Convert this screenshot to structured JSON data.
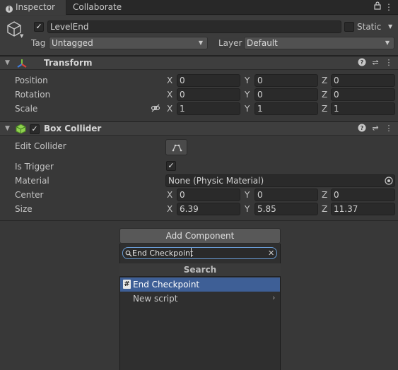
{
  "tabs": {
    "inspector": "Inspector",
    "collaborate": "Collaborate",
    "lock_icon": "lock-icon",
    "menu_icon": "kebab-menu-icon"
  },
  "object": {
    "active_checked": true,
    "name": "LevelEnd",
    "static_label": "Static",
    "tag_label": "Tag",
    "tag_value": "Untagged",
    "layer_label": "Layer",
    "layer_value": "Default"
  },
  "transform": {
    "title": "Transform",
    "position_label": "Position",
    "rotation_label": "Rotation",
    "scale_label": "Scale",
    "axis_x": "X",
    "axis_y": "Y",
    "axis_z": "Z",
    "position": {
      "x": "0",
      "y": "0",
      "z": "0"
    },
    "rotation": {
      "x": "0",
      "y": "0",
      "z": "0"
    },
    "scale": {
      "x": "1",
      "y": "1",
      "z": "1"
    }
  },
  "box_collider": {
    "title": "Box Collider",
    "enabled": true,
    "edit_collider_label": "Edit Collider",
    "is_trigger_label": "Is Trigger",
    "is_trigger_checked": true,
    "material_label": "Material",
    "material_value": "None (Physic Material)",
    "center_label": "Center",
    "size_label": "Size",
    "center": {
      "x": "0",
      "y": "0",
      "z": "0"
    },
    "size": {
      "x": "6.39",
      "y": "5.85",
      "z": "11.37"
    }
  },
  "add_component": {
    "button_label": "Add Component",
    "search_value": "End Checkpoint",
    "panel_title": "Search",
    "results": [
      {
        "label": "End Checkpoint",
        "icon": "#"
      },
      {
        "label": "New script"
      }
    ]
  },
  "colors": {
    "background": "#383838",
    "selection": "#3e5f96",
    "search_focus": "#6a9dd6"
  }
}
